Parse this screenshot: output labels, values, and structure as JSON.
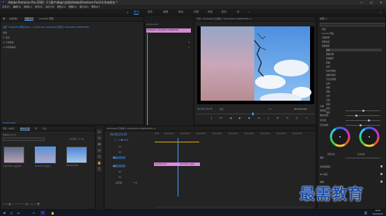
{
  "window": {
    "title": "Adobe Premiere Pro 2020 - C:\\用户\\dbqc\\文档\\Adobe\\Premiere Pro\\14.0\\未命名 *",
    "min": "—",
    "max": "□",
    "close": "✕"
  },
  "menu": [
    "文件(F)",
    "编辑(E)",
    "剪辑(C)",
    "序列(S)",
    "标记(M)",
    "图形(G)",
    "视图(V)",
    "窗口(W)",
    "帮助(H)"
  ],
  "workspaces": {
    "items": [
      "学习",
      "组件",
      "编辑",
      "颜色",
      "效果",
      "音频",
      "图形",
      "库"
    ],
    "active": 0,
    "more": "»"
  },
  "source_panel": {
    "tabs": [
      "源：（无剪辑）",
      "效果控件",
      "Lumetri 范围"
    ],
    "active_tab": 1,
    "clip_line": "主要 * DSC04263 剪辑.JPG[1]… 0:00:00:00 ▸ DSC04263 已剪辑 1 DSC04263 COMPOSITED",
    "rows": [
      "视频",
      "fx 运动",
      "fx 不透明度",
      "fx 时间重映射"
    ],
    "time": "00:00:23:05"
  },
  "timeline_mini": {
    "timecode": "00;00;20;00",
    "clip": "DSC04263 1 DSC04263 COMPOSITED"
  },
  "program": {
    "title": "节目：DSC04263 已剪辑 1 DSC04263 COMPOSITED ≡",
    "timecode": "00:00:23:05",
    "fit": "适合",
    "scale": "1/2",
    "duration": "00:00:40:28"
  },
  "transport": [
    "⇤",
    "◂",
    "{",
    "⏮",
    "◀",
    "▶",
    "▶",
    "⏭",
    "}",
    "⇥",
    "⊕",
    "⊡",
    "⎙",
    "+"
  ],
  "project": {
    "tabs": [
      "项目：未命名",
      "媒体浏览器",
      "库",
      "信息",
      "效果",
      "标记",
      "历史记录"
    ],
    "active_tab": 0,
    "file": "未命名.prproj",
    "search": "",
    "count": "1 项选择，共 3 项",
    "items": [
      "DSC04263 已剪辑.JPG",
      "DSC04263 已剪辑 1",
      "DSC04263.JPG"
    ],
    "selected": 1
  },
  "tools": [
    "▸",
    "⇥",
    "✥",
    "↔",
    "✎",
    "✋",
    "T"
  ],
  "timeline": {
    "tab": "DSC04263 已剪辑 1 DSC04263 COMPOSITED ≡",
    "timecode": "00;00;23;05",
    "ruler": [
      "00;00",
      "00;00;16;00",
      "00;00;32;00",
      "00;00;48;00",
      "00;01;04;02",
      "00;01;20;02",
      "00;01;36;02",
      "00;01;52;02",
      "00;02;08;04",
      "00;02;24;04"
    ],
    "tracks": [
      "V3",
      "V2",
      "V1",
      "A1",
      "A2",
      "A3",
      "主声道"
    ],
    "master_level": "0.0",
    "clips": [
      "DSC04263.JPG",
      "DSC04263 已剪辑"
    ]
  },
  "effects": {
    "title": "效果 ≡",
    "tree": [
      "预设",
      "Lumetri 预设",
      "音频效果",
      "音频过渡",
      "视频效果",
      "变换",
      "图像控制",
      "实用程序",
      "扭曲",
      "时间",
      "杂色与颗粒",
      "模糊与锐化",
      "沉浸式视频",
      "生成",
      "视频",
      "调整",
      "过时",
      "过渡",
      "透视",
      "通道",
      "键控"
    ],
    "lumetri": {
      "rows": [
        "平衡",
        "饱和度",
        "阴影色调",
        "对比度",
        "高光色调"
      ],
      "wheels": [
        "阴影色调",
        "高光色调"
      ],
      "bottom": [
        "锐化",
        "自然饱和度",
        "Bit 深度",
        "暗角"
      ]
    }
  },
  "taskbar": {
    "time": "15:09",
    "date": "2021/10/15",
    "ime": "英"
  },
  "watermark": "最需教育"
}
